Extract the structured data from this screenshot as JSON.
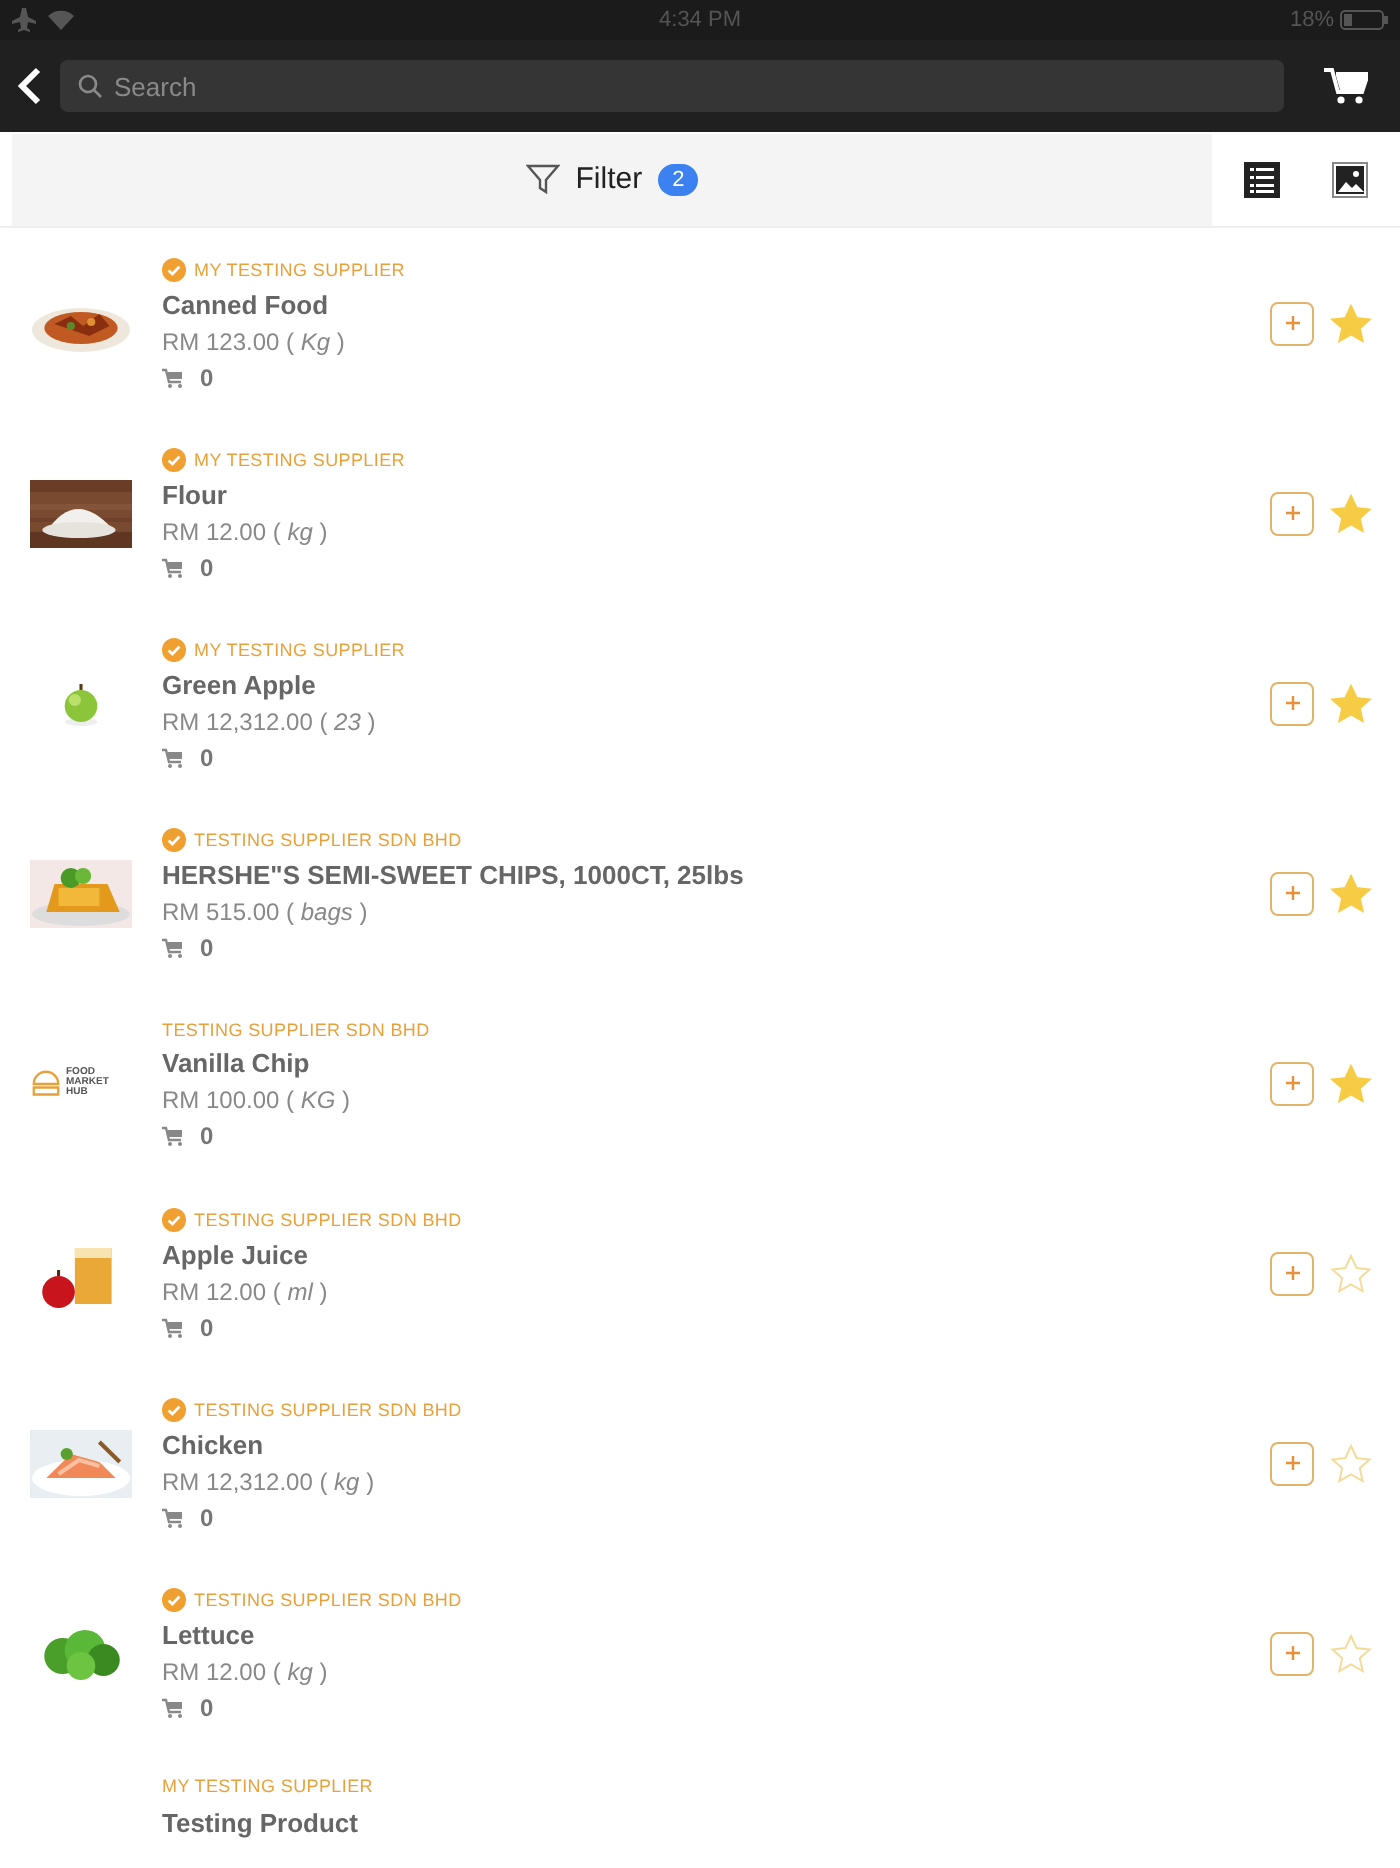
{
  "status_bar": {
    "time": "4:34 PM",
    "battery": "18%"
  },
  "nav": {
    "search": {
      "placeholder": "Search"
    }
  },
  "filter_bar": {
    "label": "Filter",
    "count": "2"
  },
  "products": [
    {
      "supplier": "MY TESTING SUPPLIER",
      "verified": true,
      "name": "Canned Food",
      "price": "RM 123.00 ( *Kg* )",
      "cart_count": "0",
      "starred": true
    },
    {
      "supplier": "MY TESTING SUPPLIER",
      "verified": true,
      "name": "Flour",
      "price": "RM 12.00 ( *kg* )",
      "cart_count": "0",
      "starred": true
    },
    {
      "supplier": "MY TESTING SUPPLIER",
      "verified": true,
      "name": "Green Apple",
      "price": "RM 12,312.00 ( *23* )",
      "cart_count": "0",
      "starred": true
    },
    {
      "supplier": "TESTING SUPPLIER SDN BHD",
      "verified": true,
      "name": "HERSHE\"S SEMI-SWEET CHIPS, 1000CT, 25lbs",
      "price": "RM 515.00 ( *bags* )",
      "cart_count": "0",
      "starred": true
    },
    {
      "supplier": "TESTING SUPPLIER SDN BHD",
      "verified": false,
      "name": "Vanilla Chip",
      "price": "RM 100.00 ( *KG* )",
      "cart_count": "0",
      "starred": true,
      "image": {
        "kind": "logo",
        "text": "FOOD MARKET HUB"
      }
    },
    {
      "supplier": "TESTING SUPPLIER SDN BHD",
      "verified": true,
      "name": "Apple Juice",
      "price": "RM 12.00 ( *ml* )",
      "cart_count": "0",
      "starred": false
    },
    {
      "supplier": "TESTING SUPPLIER SDN BHD",
      "verified": true,
      "name": "Chicken",
      "price": "RM 12,312.00 ( *kg* )",
      "cart_count": "0",
      "starred": false
    },
    {
      "supplier": "TESTING SUPPLIER SDN BHD",
      "verified": true,
      "name": "Lettuce",
      "price": "RM 12.00 ( *kg* )",
      "cart_count": "0",
      "starred": false
    },
    {
      "supplier": "MY TESTING SUPPLIER",
      "verified": false,
      "name": "Testing Product"
    }
  ]
}
